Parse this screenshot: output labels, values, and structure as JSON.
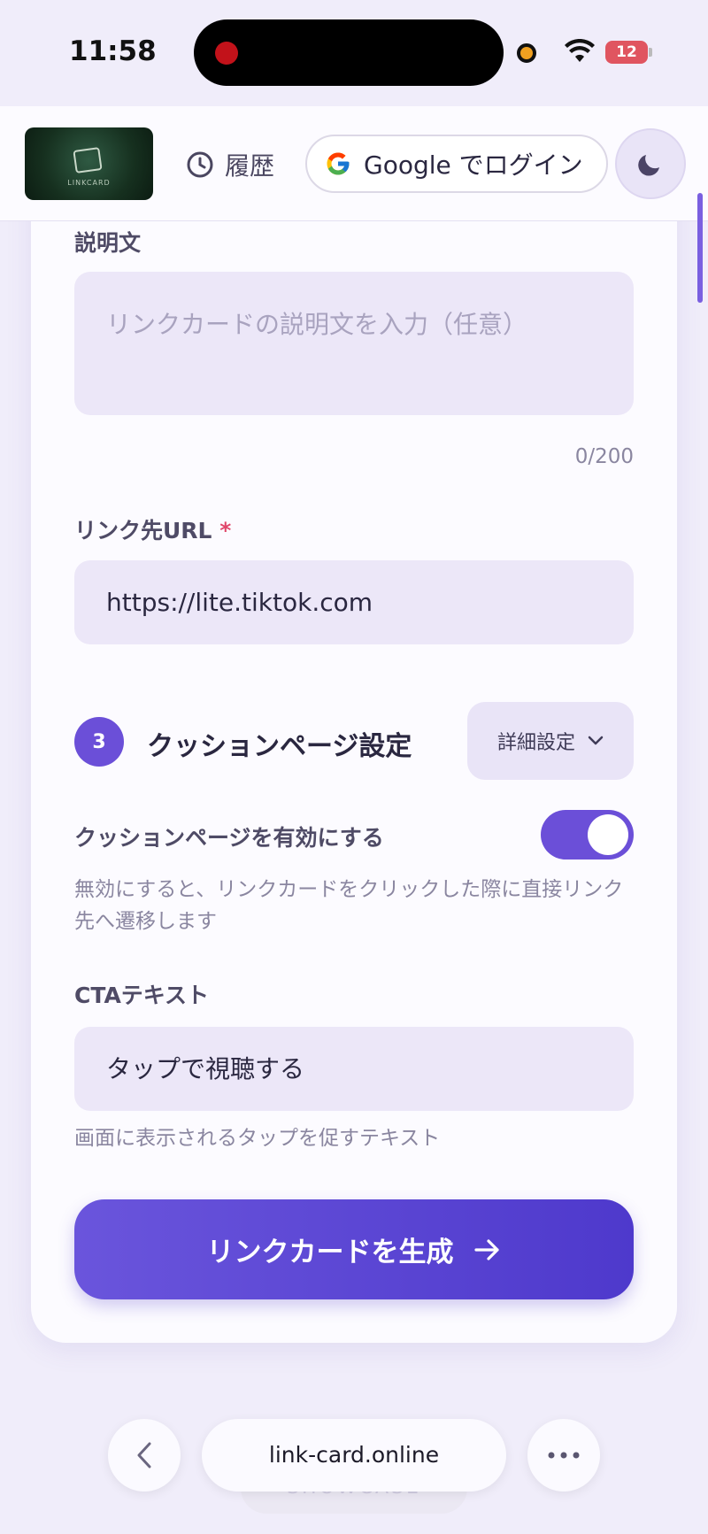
{
  "status_bar": {
    "time": "11:58",
    "battery": "12"
  },
  "header": {
    "logo_text": "LINKCARD",
    "history_label": "履歴",
    "login_label": "Google でログイン"
  },
  "form": {
    "description": {
      "label": "説明文",
      "placeholder": "リンクカードの説明文を入力（任意）",
      "counter": "0/200"
    },
    "url": {
      "label": "リンク先URL",
      "required_mark": "*",
      "value": "https://lite.tiktok.com"
    },
    "section3": {
      "number": "3",
      "title": "クッションページ設定",
      "detail_button": "詳細設定"
    },
    "cushion_toggle": {
      "label": "クッションページを有効にする",
      "help": "無効にすると、リンクカードをクリックした際に直接リンク先へ遷移します",
      "enabled": true
    },
    "cta": {
      "label": "CTAテキスト",
      "value": "タップで視聴する",
      "help": "画面に表示されるタップを促すテキスト"
    },
    "submit_label": "リンクカードを生成"
  },
  "browser_bar": {
    "url": "link-card.online",
    "behind_label": "SHOWCASE"
  },
  "colors": {
    "accent": "#6b4fd8",
    "background": "#f0edfa"
  }
}
